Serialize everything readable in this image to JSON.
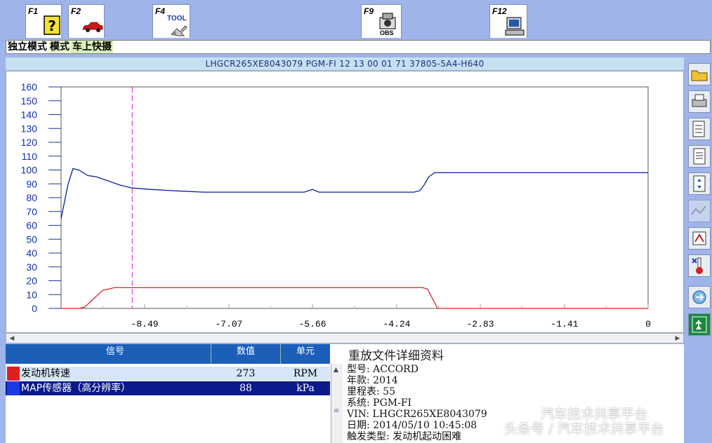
{
  "toolbar": {
    "f1": {
      "key": "F1",
      "icon": "help-icon"
    },
    "f2": {
      "key": "F2",
      "icon": "car-icon"
    },
    "f4": {
      "key": "F4",
      "icon": "tool-icon",
      "caption": "TOOL"
    },
    "f9": {
      "key": "F9",
      "icon": "obs-icon",
      "caption": "OBS"
    },
    "f12": {
      "key": "F12",
      "icon": "computer-icon"
    }
  },
  "modes": [
    "独立模式",
    "模式",
    "车上快摄"
  ],
  "vehicle_info": "LHGCR265XE8043079  PGM-FI  12 13 00 01 71  37805-5A4-H640",
  "colors": {
    "rpm": "#e02020",
    "map": "#0a1fa0",
    "marker": "#d020c0"
  },
  "chart_data": {
    "type": "line",
    "y_ticks": [
      "160",
      "150",
      "140",
      "130",
      "120",
      "110",
      "100",
      "90",
      "80",
      "70",
      "60",
      "50",
      "40",
      "30",
      "20",
      "10",
      "0"
    ],
    "x_ticks": [
      "-8.49",
      "-7.07",
      "-5.66",
      "-4.24",
      "-2.83",
      "-1.41",
      "0"
    ],
    "ylim": [
      0,
      160
    ],
    "xlim": [
      -9.9,
      0
    ],
    "marker_x": -8.7,
    "series": [
      {
        "name": "MAP传感器（高分辨率）",
        "color": "#0a1fa0",
        "x": [
          -9.9,
          -9.78,
          -9.7,
          -9.6,
          -9.45,
          -9.3,
          -9.1,
          -8.9,
          -8.7,
          -8.4,
          -8.0,
          -7.5,
          -7.0,
          -6.5,
          -6.0,
          -5.8,
          -5.66,
          -5.55,
          -5.3,
          -5.0,
          -4.5,
          -4.2,
          -3.95,
          -3.85,
          -3.78,
          -3.7,
          -3.6,
          -3.0,
          -2.0,
          -1.0,
          0
        ],
        "y": [
          65,
          90,
          101,
          100,
          96,
          95,
          92,
          89,
          87,
          86,
          85,
          84,
          84,
          84,
          84,
          84,
          86,
          84,
          84,
          84,
          84,
          84,
          84,
          85,
          89,
          95,
          98,
          98,
          98,
          98,
          98
        ]
      },
      {
        "name": "发动机转速",
        "color": "#e02020",
        "x": [
          -9.9,
          -9.6,
          -9.5,
          -9.4,
          -9.2,
          -9.0,
          -8.7,
          -8.0,
          -7.0,
          -6.0,
          -5.0,
          -4.2,
          -3.8,
          -3.72,
          -3.55,
          -3.5,
          -2.0,
          0
        ],
        "y": [
          0,
          0,
          1,
          5,
          13,
          15,
          15,
          15,
          15,
          15,
          15,
          15,
          15,
          14,
          0,
          0,
          0,
          0
        ]
      }
    ]
  },
  "signal_table": {
    "headers": [
      "信号",
      "数值",
      "单元"
    ],
    "rows": [
      {
        "name": "发动机转速",
        "value": "273",
        "unit": "RPM",
        "color": "#e02020"
      },
      {
        "name": "MAP传感器（高分辨率）",
        "value": "88",
        "unit": "kPa",
        "color": "#0a1fa0"
      }
    ]
  },
  "detail": {
    "title": "重放文件详细资料",
    "lines": [
      "型号: ACCORD",
      "年款: 2014",
      "里程表:  55",
      "系统: PGM-FI",
      "VIN: LHGCR265XE8043079",
      "日期: 2014/05/10 10:45:08",
      "触发类型: 发动机起动困难"
    ]
  },
  "right_tools": [
    "open-folder-icon",
    "print-icon",
    "settings-icon",
    "document-icon",
    "layout-icon",
    "disabled-tool-icon",
    "config-icon",
    "temperature-icon",
    "refresh-icon",
    "exit-icon"
  ],
  "watermarks": [
    "汽车技术共享平台",
    "头条号 / 汽车技术共享平台"
  ]
}
